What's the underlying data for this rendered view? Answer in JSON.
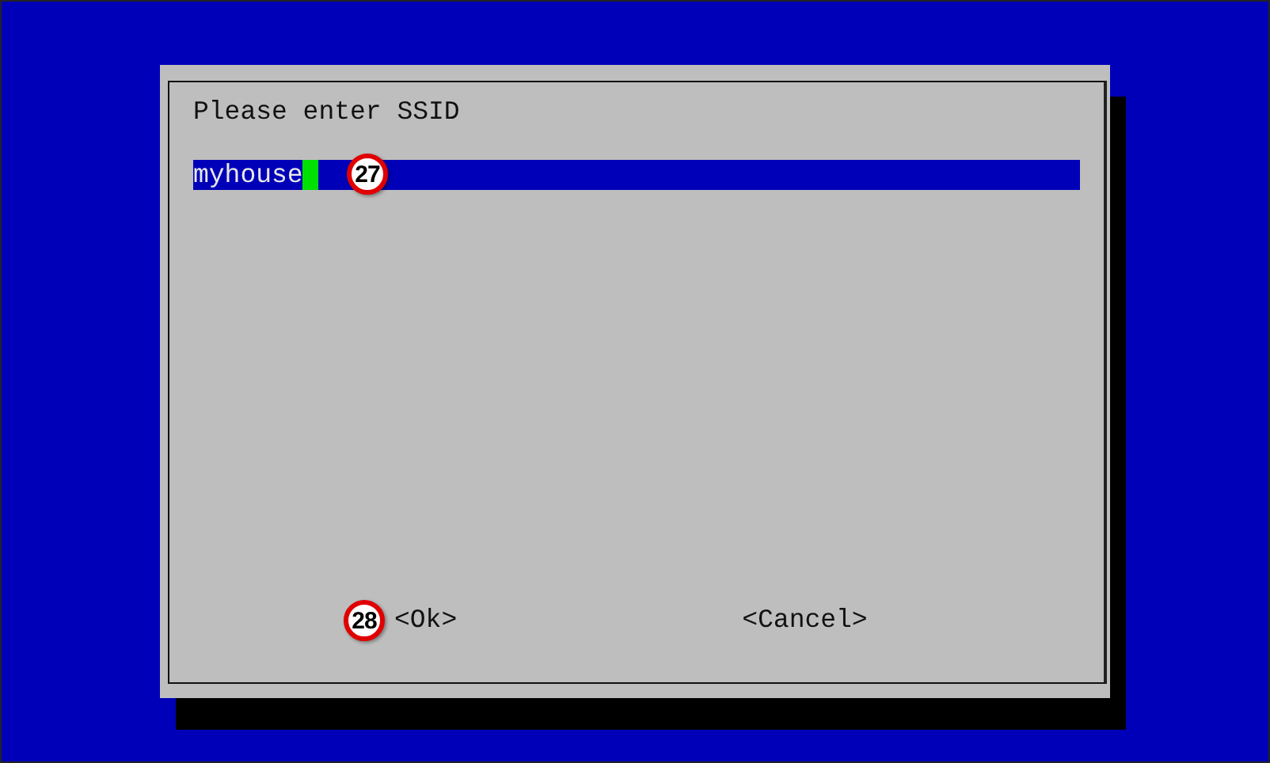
{
  "dialog": {
    "prompt": "Please enter SSID",
    "field": {
      "value": "myhouse",
      "cursor": true,
      "callout": "27"
    },
    "buttons": [
      {
        "label": "<Ok>",
        "callout": "28"
      },
      {
        "label": "<Cancel>"
      }
    ]
  }
}
